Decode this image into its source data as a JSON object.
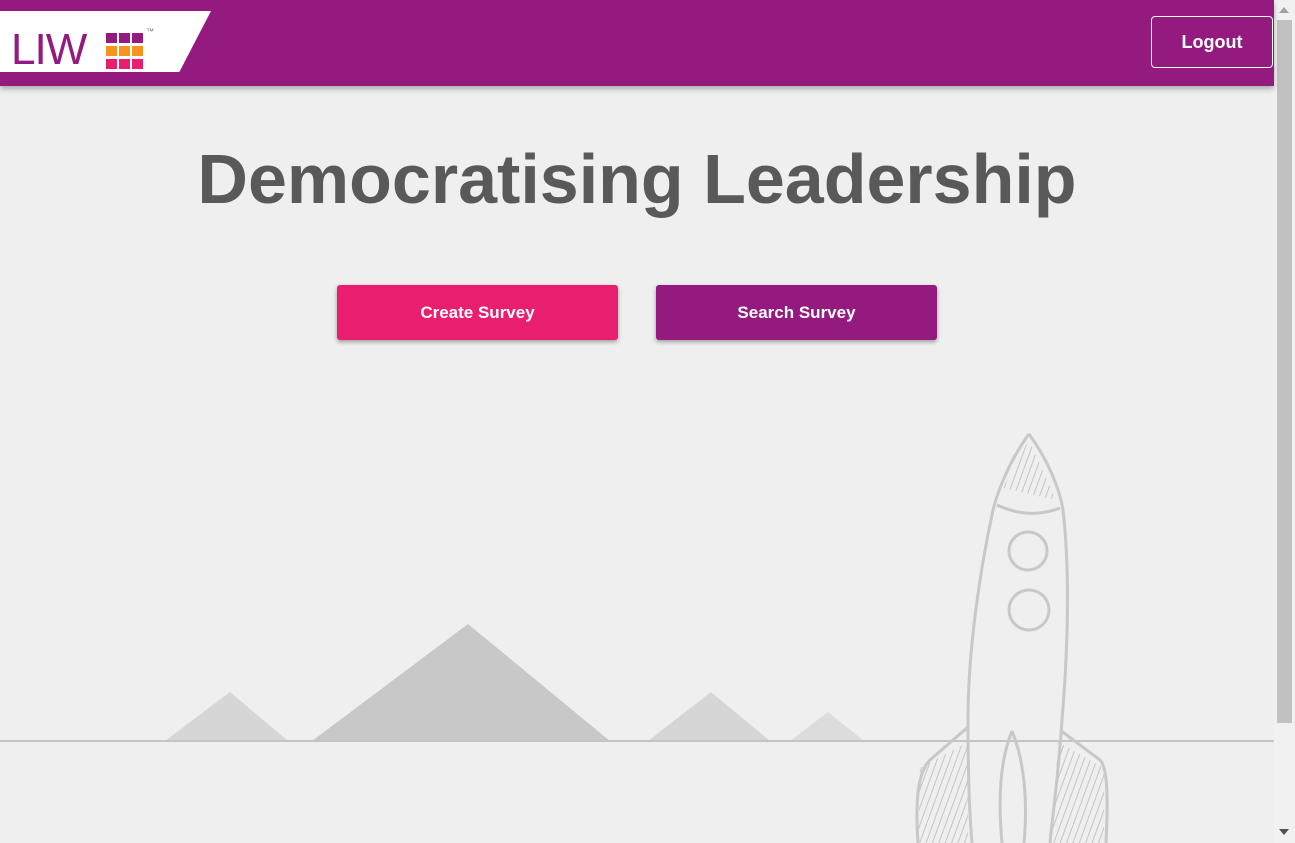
{
  "header": {
    "logo_text": "LIW",
    "logo_tm": "™",
    "logout_label": "Logout",
    "background_color": "#941a80"
  },
  "main": {
    "headline": "Democratising Leadership",
    "create_survey_label": "Create Survey",
    "search_survey_label": "Search Survey"
  },
  "colors": {
    "brand_purple": "#941a80",
    "brand_pink": "#e91e6e",
    "logo_orange": "#f7941d",
    "page_background": "#efefef",
    "headline_gray": "#595959"
  },
  "icons": {
    "logo_grid": "logo-grid-icon",
    "scroll_up": "scroll-up-arrow-icon",
    "scroll_down": "scroll-down-arrow-icon",
    "rocket": "rocket-illustration",
    "mountains": "mountains-illustration"
  }
}
